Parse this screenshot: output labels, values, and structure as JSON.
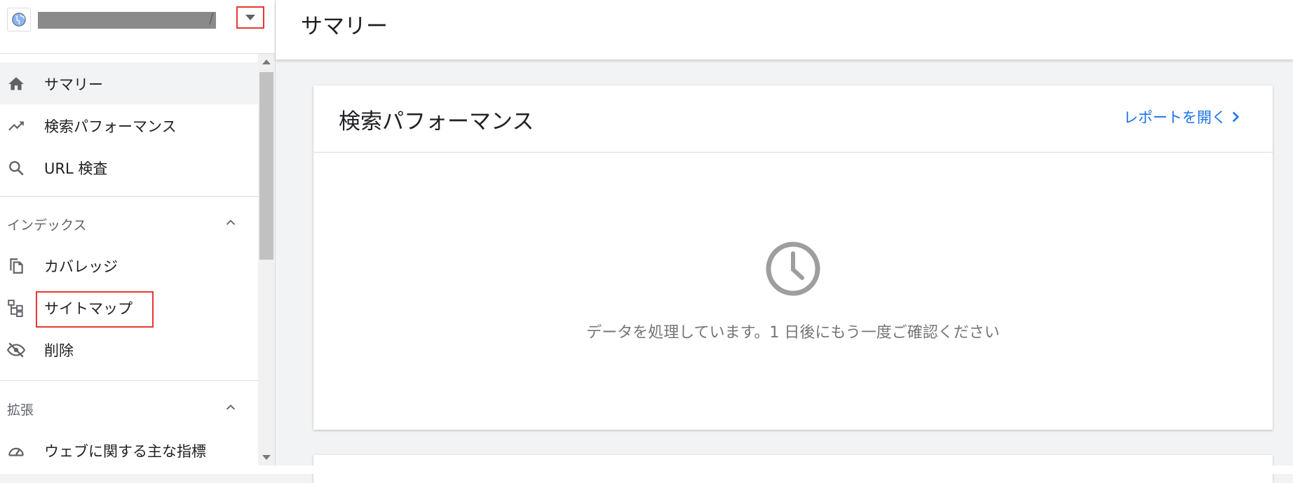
{
  "property": {
    "name_redacted": true,
    "name_tail": "/"
  },
  "nav": {
    "summary": "サマリー",
    "performance": "検索パフォーマンス",
    "url_inspection": "URL 検査",
    "index_section": "インデックス",
    "coverage": "カバレッジ",
    "sitemaps": "サイトマップ",
    "removals": "削除",
    "enhancements_section": "拡張",
    "core_web_vitals": "ウェブに関する主な指標"
  },
  "page": {
    "title": "サマリー"
  },
  "performance_card": {
    "title": "検索パフォーマンス",
    "open_report": "レポートを開く",
    "processing_message": "データを処理しています。1 日後にもう一度ご確認ください"
  },
  "colors": {
    "accent": "#1a73e8",
    "highlight_box": "#e53935",
    "active_item_bg": "#f1f3f4",
    "icon": "#5f6368",
    "clock": "#9e9e9e"
  },
  "icons": {
    "property": "globe-icon",
    "dropdown": "caret-down-icon",
    "summary": "home-icon",
    "performance": "trending-up-icon",
    "url_inspection": "search-icon",
    "coverage": "copy-icon",
    "sitemaps": "sitemap-icon",
    "removals": "eye-off-icon",
    "core_web_vitals": "speedometer-icon",
    "section_toggle": "chevron-up-icon",
    "open_report": "chevron-right-icon",
    "processing": "clock-icon"
  }
}
